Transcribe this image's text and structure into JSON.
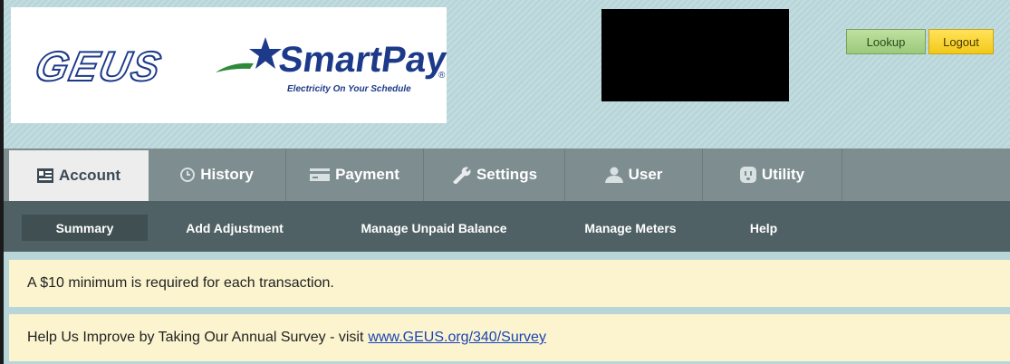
{
  "branding": {
    "logo_geus": "GEUS",
    "logo_smartpay": "SmartPay",
    "registered_mark": "®",
    "tagline": "Electricity On Your Schedule"
  },
  "header_buttons": {
    "lookup_label": "Lookup",
    "logout_label": "Logout"
  },
  "tabs": [
    {
      "label": "Account",
      "icon": "account-card-icon",
      "active": true
    },
    {
      "label": "History",
      "icon": "clock-icon",
      "active": false
    },
    {
      "label": "Payment",
      "icon": "credit-card-icon",
      "active": false
    },
    {
      "label": "Settings",
      "icon": "wrench-icon",
      "active": false
    },
    {
      "label": "User",
      "icon": "user-icon",
      "active": false
    },
    {
      "label": "Utility",
      "icon": "outlet-icon",
      "active": false
    }
  ],
  "subnav": [
    {
      "label": "Summary",
      "active": true
    },
    {
      "label": "Add Adjustment",
      "active": false
    },
    {
      "label": "Manage Unpaid Balance",
      "active": false
    },
    {
      "label": "Manage Meters",
      "active": false
    },
    {
      "label": "Help",
      "active": false
    }
  ],
  "notices": {
    "minimum": "A $10 minimum is required for each transaction.",
    "survey_text": "Help Us Improve by Taking Our Annual Survey - visit",
    "survey_link": "www.GEUS.org/340/Survey"
  },
  "colors": {
    "brand_blue": "#1d3a8a",
    "brand_green": "#2e8a3a",
    "lookup_green": "#9bc97a",
    "logout_yellow": "#f3c818",
    "tab_bar": "#7d8d90",
    "subnav_bar": "#4f6164",
    "notice_bg": "#fbf4cf"
  }
}
